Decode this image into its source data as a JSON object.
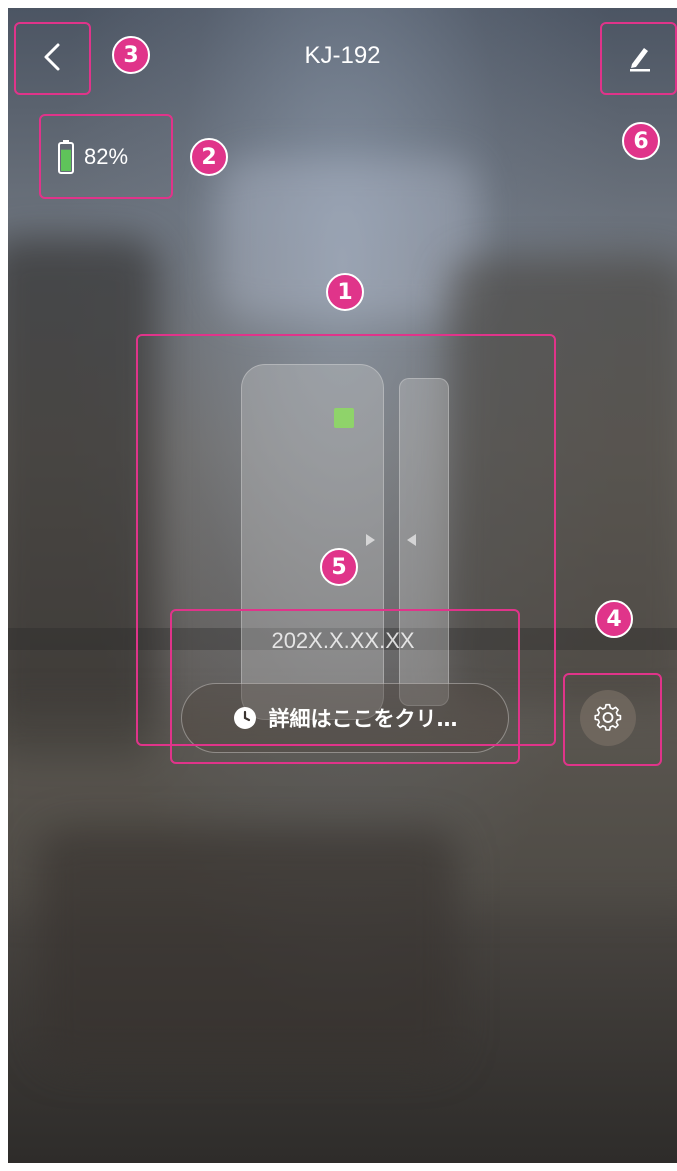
{
  "header": {
    "title": "KJ-192",
    "back_icon": "chevron-left-icon",
    "edit_icon": "pencil-icon"
  },
  "battery": {
    "percent_text": "82%",
    "level": 0.82,
    "icon": "battery-icon",
    "fill_color": "#5fc35a"
  },
  "sensor": {
    "led_color": "#8fd36a",
    "icons": [
      "door-sensor-body",
      "door-sensor-magnet"
    ]
  },
  "event": {
    "timestamp": "202X.X.XX.XX",
    "detail_button_label": "詳細はここをクリ…",
    "clock_icon": "clock-icon"
  },
  "settings": {
    "icon": "gear-icon"
  },
  "annotations": {
    "color": "#e0348a",
    "badges": [
      "1",
      "2",
      "3",
      "4",
      "5",
      "6"
    ]
  }
}
